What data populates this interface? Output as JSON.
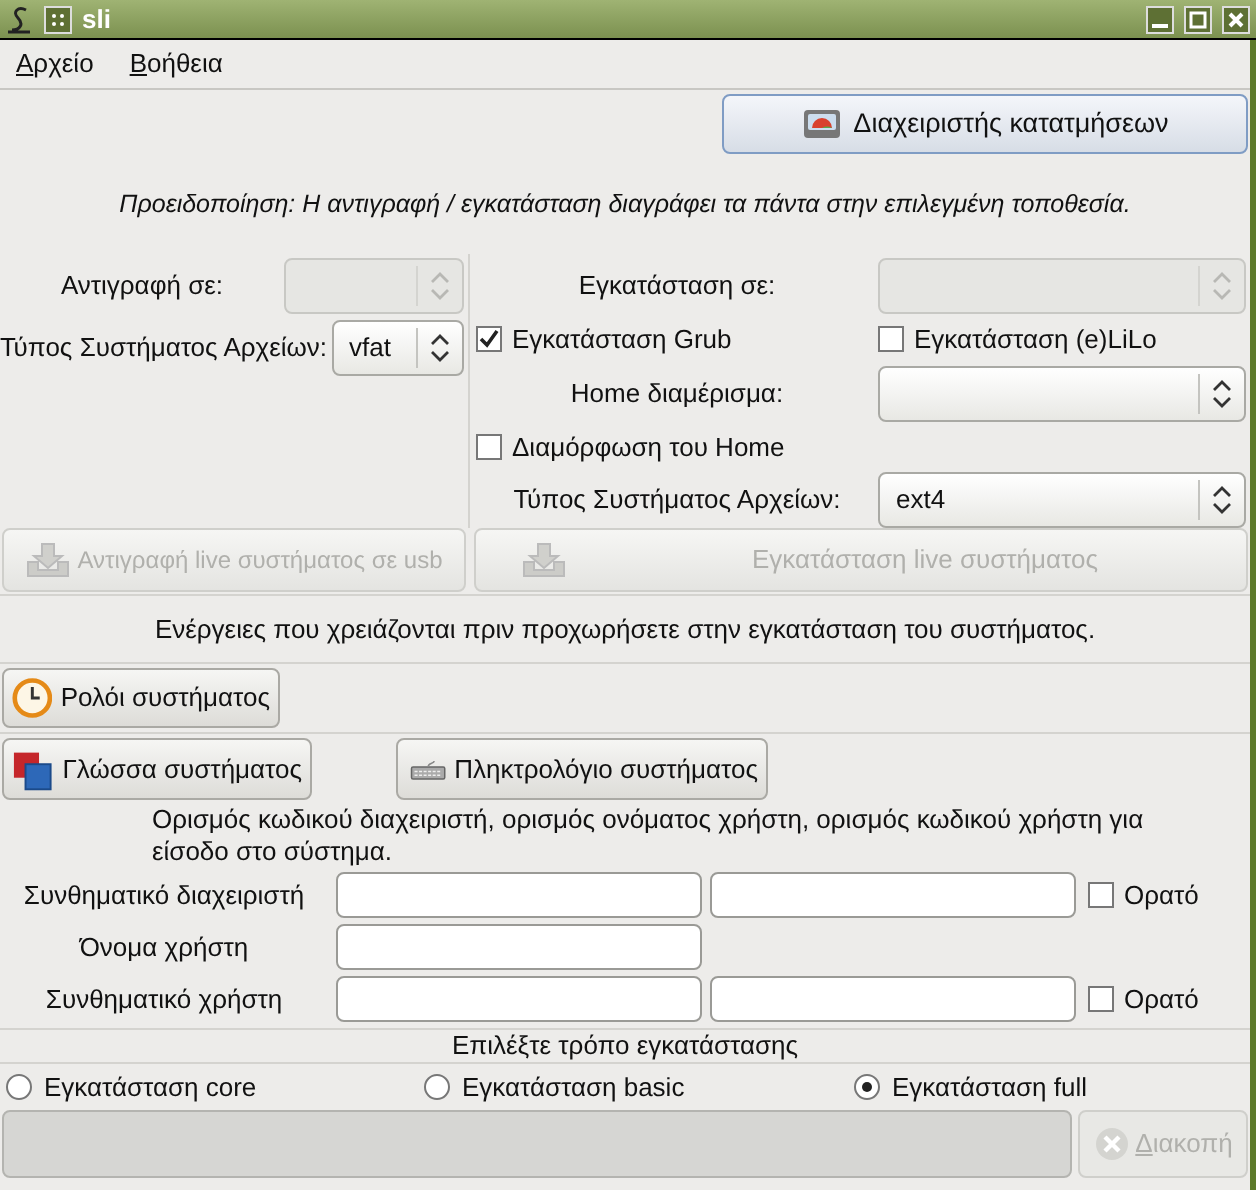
{
  "window": {
    "title": "sli"
  },
  "menu": [
    {
      "label": "Αρχείο"
    },
    {
      "label": "Βοήθεια"
    }
  ],
  "partition_button": {
    "label": "Διαχειριστής κατατμήσεων"
  },
  "warning": "Προειδοποίηση: Η αντιγραφή / εγκατάσταση διαγράφει τα πάντα στην επιλεγμένη τοποθεσία.",
  "copy_to": {
    "label": "Αντιγραφή σε:",
    "disabled": true
  },
  "copy_fs": {
    "label": "Τύπος Συστήματος Αρχείων:",
    "value": "vfat",
    "disabled": false
  },
  "install_to": {
    "label": "Εγκατάσταση σε:",
    "disabled": true
  },
  "grub": {
    "label": "Εγκατάσταση Grub",
    "checked": true
  },
  "elilo": {
    "label": "Εγκατάσταση (e)LiLo",
    "checked": false
  },
  "home_partition": {
    "label": "Home διαμέρισμα:",
    "disabled": false
  },
  "format_home": {
    "label": "Διαμόρφωση του Home",
    "checked": false
  },
  "install_fs": {
    "label": "Τύπος Συστήματος Αρχείων:",
    "value": "ext4",
    "disabled": false
  },
  "copy_button": {
    "label": "Αντιγραφή live συστήματος σε usb",
    "disabled": true
  },
  "install_button": {
    "label": "Εγκατάσταση live συστήματος",
    "disabled": true
  },
  "actions_note": "Ενέργειες που χρειάζονται πριν προχωρήσετε στην εγκατάσταση του συστήματος.",
  "clock_button": {
    "label": "Ρολόι συστήματος"
  },
  "language_button": {
    "label": "Γλώσσα συστήματος"
  },
  "keyboard_button": {
    "label": "Πληκτρολόγιο συστήματος"
  },
  "accounts_note": "Ορισμός κωδικού διαχειριστή, ορισμός ονόματος χρήστη, ορισμός κωδικού χρήστη για είσοδο στο σύστημα.",
  "fields": [
    {
      "label": "Συνθηματικό διαχειριστή",
      "kind": "password",
      "show_label": "Ορατό",
      "checked": false
    },
    {
      "label": "Όνομα χρήστη",
      "kind": "text"
    },
    {
      "label": "Συνθηματικό χρήστη",
      "kind": "password",
      "show_label": "Ορατό",
      "checked": false
    }
  ],
  "mode_heading": "Επιλέξτε τρόπο εγκατάστασης",
  "modes": [
    {
      "label": "Εγκατάσταση core",
      "selected": false
    },
    {
      "label": "Εγκατάσταση basic",
      "selected": false
    },
    {
      "label": "Εγκατάσταση full",
      "selected": true
    }
  ],
  "progress": {
    "level": 0
  },
  "cancel_button": {
    "label": "Διακοπή",
    "disabled": true
  }
}
